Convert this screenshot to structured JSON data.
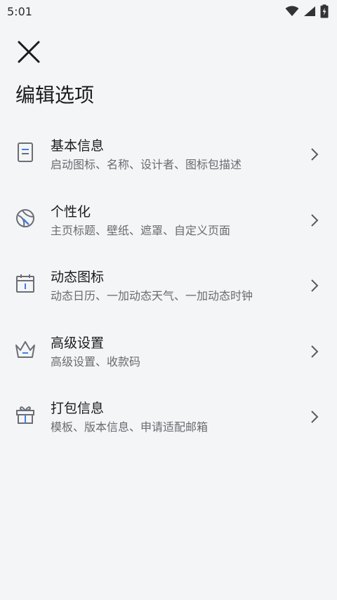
{
  "status_bar": {
    "time": "5:01",
    "icons": [
      "wifi-icon",
      "signal-icon",
      "battery-icon"
    ]
  },
  "toolbar": {
    "close_icon": "close-icon"
  },
  "page": {
    "title": "编辑选项"
  },
  "menu": {
    "items": [
      {
        "title": "基本信息",
        "subtitle": "启动图标、名称、设计者、图标包描述",
        "icon": "document-icon"
      },
      {
        "title": "个性化",
        "subtitle": "主页标题、壁纸、遮罩、自定义页面",
        "icon": "palette-icon"
      },
      {
        "title": "动态图标",
        "subtitle": "动态日历、一加动态天气、一加动态时钟",
        "icon": "calendar-icon"
      },
      {
        "title": "高级设置",
        "subtitle": "高级设置、收款码",
        "icon": "crown-icon"
      },
      {
        "title": "打包信息",
        "subtitle": "模板、版本信息、申请适配邮箱",
        "icon": "gift-icon"
      }
    ]
  },
  "colors": {
    "background": "#f4f5f7",
    "icon_gray": "#6b6e75",
    "accent_blue": "#3f7fe6",
    "subtitle": "#6a6b70"
  }
}
